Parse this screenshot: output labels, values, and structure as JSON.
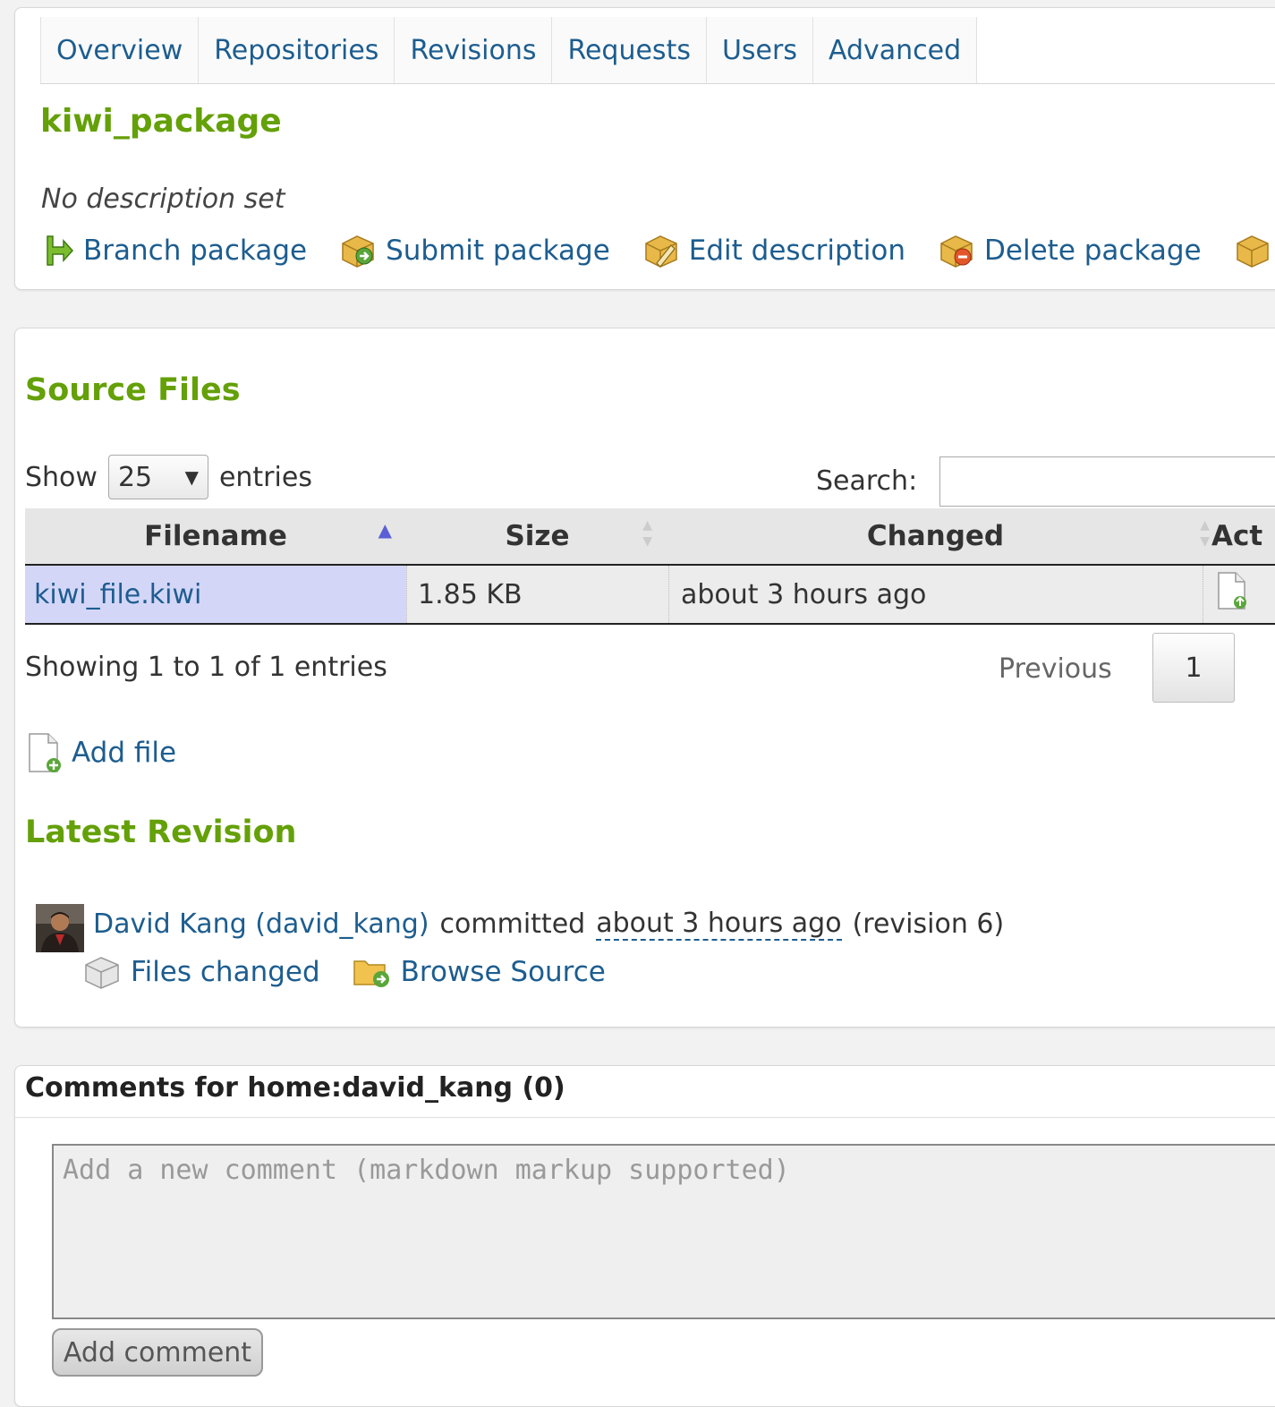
{
  "tabs": [
    "Overview",
    "Repositories",
    "Revisions",
    "Requests",
    "Users",
    "Advanced"
  ],
  "package": {
    "name": "kiwi_package",
    "description": "No description set",
    "actions": [
      {
        "label": "Branch package",
        "icon": "branch-arrow-icon"
      },
      {
        "label": "Submit package",
        "icon": "package-submit-icon"
      },
      {
        "label": "Edit description",
        "icon": "package-edit-icon"
      },
      {
        "label": "Delete package",
        "icon": "package-delete-icon"
      }
    ]
  },
  "source_files": {
    "title": "Source Files",
    "show_label": "Show",
    "page_length": "25",
    "entries_label": "entries",
    "search_label": "Search:",
    "columns": [
      "Filename",
      "Size",
      "Changed",
      "Act"
    ],
    "rows": [
      {
        "filename": "kiwi_file.kiwi",
        "size": "1.85 KB",
        "changed": "about 3 hours ago"
      }
    ],
    "info": "Showing 1 to 1 of 1 entries",
    "previous_label": "Previous",
    "current_page": "1",
    "add_file_label": "Add file"
  },
  "latest_revision": {
    "title": "Latest Revision",
    "author": "David Kang (david_kang)",
    "committed": "committed",
    "when": "about 3 hours ago",
    "revision": "(revision 6)",
    "files_changed_label": "Files changed",
    "browse_source_label": "Browse Source"
  },
  "comments": {
    "title": "Comments for home:david_kang (0)",
    "placeholder": "Add a new comment (markdown markup supported)",
    "button_label": "Add comment"
  },
  "colors": {
    "heading_green": "#64a008",
    "link_blue": "#1d5d8f",
    "selected_cell": "#d4d6f8"
  }
}
